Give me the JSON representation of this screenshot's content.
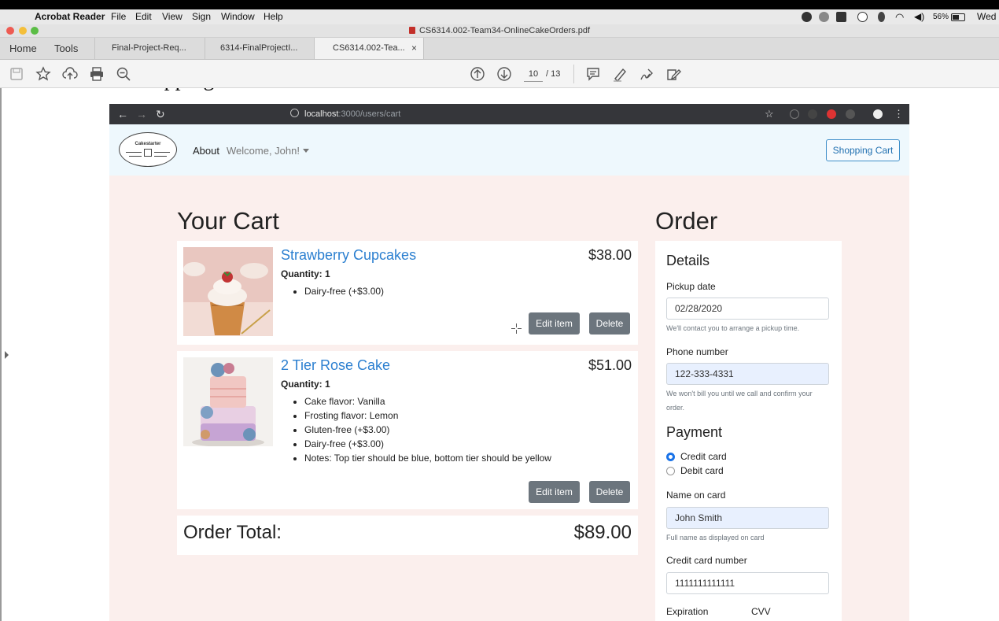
{
  "macos": {
    "app_name": "Acrobat Reader",
    "menus": [
      "File",
      "Edit",
      "View",
      "Sign",
      "Window",
      "Help"
    ],
    "battery": "56%",
    "day": "Wed"
  },
  "window": {
    "doc_title": "CS6314.002-Team34-OnlineCakeOrders.pdf"
  },
  "tabs": {
    "home": "Home",
    "tools": "Tools",
    "docs": [
      "Final-Project-Req...",
      "6314-FinalProjectI...",
      "CS6314.002-Tea..."
    ],
    "close": "×"
  },
  "pager": {
    "current": "10",
    "total": "/ 13"
  },
  "pdf": {
    "heading": "Shopping Cart and Order Form"
  },
  "browser": {
    "url_host": "localhost",
    "url_path": ":3000/users/cart"
  },
  "site": {
    "logo_text": "Cakestarter",
    "nav_about": "About",
    "nav_welcome": "Welcome, John!",
    "cart_button": "Shopping Cart"
  },
  "cart": {
    "title": "Your Cart",
    "items": [
      {
        "name": "Strawberry Cupcakes",
        "price": "$38.00",
        "quantity": "Quantity: 1",
        "options": [
          "Dairy-free (+$3.00)"
        ],
        "edit_label": "Edit item",
        "delete_label": "Delete"
      },
      {
        "name": "2 Tier Rose Cake",
        "price": "$51.00",
        "quantity": "Quantity: 1",
        "options": [
          "Cake flavor: Vanilla",
          "Frosting flavor: Lemon",
          "Gluten-free (+$3.00)",
          "Dairy-free (+$3.00)",
          "Notes: Top tier should be blue, bottom tier should be yellow"
        ],
        "edit_label": "Edit item",
        "delete_label": "Delete"
      }
    ],
    "total_label": "Order Total:",
    "total_value": "$89.00"
  },
  "order": {
    "title": "Order",
    "details_heading": "Details",
    "pickup_label": "Pickup date",
    "pickup_value": "02/28/2020",
    "pickup_help": "We'll contact you to arrange a pickup time.",
    "phone_label": "Phone number",
    "phone_value": "122-333-4331",
    "phone_help": "We won't bill you until we call and confirm your order.",
    "payment_heading": "Payment",
    "payment_options": [
      "Credit card",
      "Debit card"
    ],
    "payment_selected": "Credit card",
    "name_label": "Name on card",
    "name_value": "John Smith",
    "name_help": "Full name as displayed on card",
    "ccnum_label": "Credit card number",
    "ccnum_value": "1111111111111",
    "expiration_label": "Expiration",
    "cvv_label": "CVV"
  },
  "colors": {
    "link": "#2b7fd0",
    "button_secondary": "#6c757d",
    "navbar_bg": "#eef8fd",
    "page_bg": "#fbefed",
    "radio_checked": "#1a73e8"
  }
}
